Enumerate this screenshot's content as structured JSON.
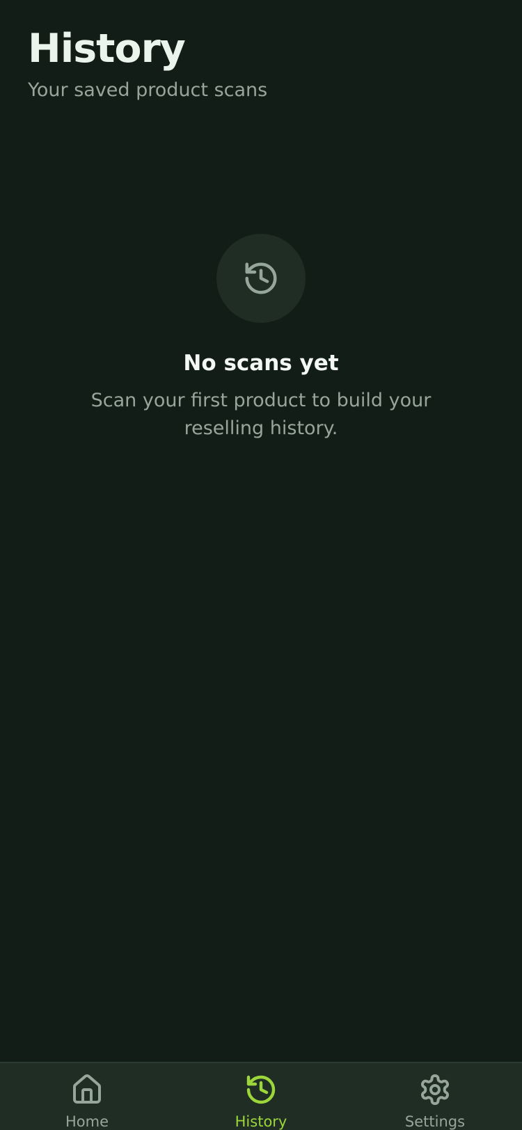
{
  "header": {
    "title": "History",
    "subtitle": "Your saved product scans"
  },
  "empty_state": {
    "icon": "history-icon",
    "title": "No scans yet",
    "description": "Scan your first product to build your reselling history."
  },
  "tabbar": {
    "active_tab": "History",
    "tabs": [
      {
        "label": "Home",
        "icon": "home-icon"
      },
      {
        "label": "History",
        "icon": "history-icon"
      },
      {
        "label": "Settings",
        "icon": "gear-icon"
      }
    ]
  },
  "colors": {
    "background": "#131d17",
    "surface": "#1f2d24",
    "accent": "#9cd63a",
    "text_primary": "#eaf4ec",
    "text_secondary": "#97a69b"
  }
}
